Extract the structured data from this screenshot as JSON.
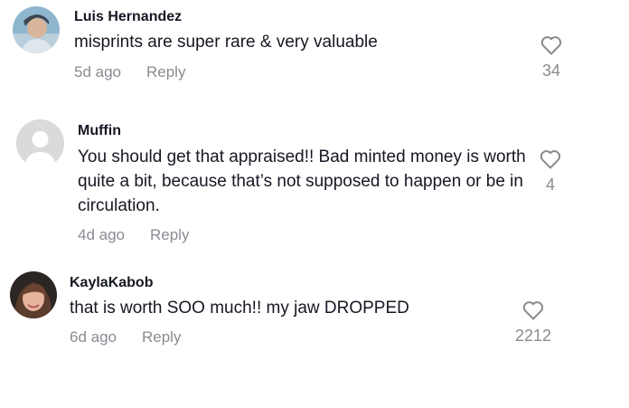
{
  "comments": [
    {
      "username": "Luis Hernandez",
      "text": "misprints are super rare & very valuable",
      "time": "5d ago",
      "reply_label": "Reply",
      "likes": "34",
      "avatar": "photo-avatar"
    },
    {
      "username": "Muffin",
      "text": "You should get that appraised!! Bad minted money is worth quite a bit, because that’s not supposed to happen or be in circulation.",
      "time": "4d ago",
      "reply_label": "Reply",
      "likes": "4",
      "avatar": "default-avatar"
    },
    {
      "username": "KaylaKabob",
      "text": "that is worth SOO much!! my jaw DROPPED",
      "time": "6d ago",
      "reply_label": "Reply",
      "likes": "2212",
      "avatar": "photo-avatar"
    }
  ],
  "icons": {
    "like": "heart-outline-icon"
  },
  "colors": {
    "text": "#161823",
    "secondary": "#8a8b91",
    "icon": "#8a8b91",
    "default_avatar": "#dadada"
  }
}
